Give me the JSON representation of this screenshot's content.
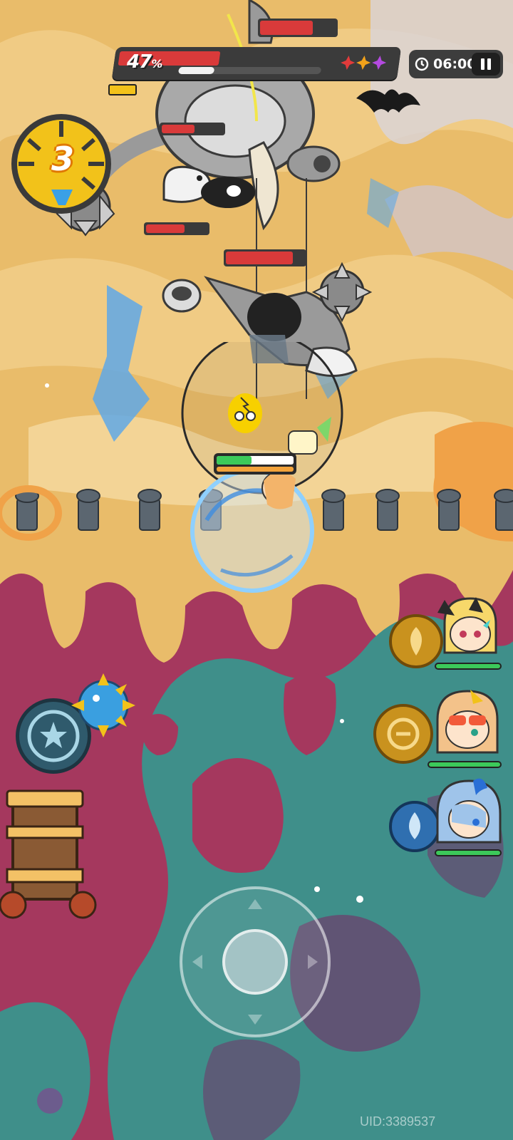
{
  "boss": {
    "hp_percent_value": "47",
    "hp_percent_symbol": "%",
    "hp_fraction": 0.47,
    "shield_fraction": 0.25
  },
  "timer": {
    "value": "06:00"
  },
  "combo": {
    "count": "3"
  },
  "player": {
    "hp_fraction": 0.45
  },
  "party": [
    {
      "name": "blonde-cat-ear-hero",
      "hp_fraction": 1.0
    },
    {
      "name": "orange-sunglasses-hero",
      "hp_fraction": 1.0
    },
    {
      "name": "blue-hair-hero",
      "hp_fraction": 1.0
    }
  ],
  "footer": {
    "uid": "UID:3389537"
  },
  "colors": {
    "sand": "#e9bc6a",
    "magenta": "#a5385e",
    "teal": "#3f8f8a",
    "hp_red": "#d93a3a",
    "hp_green": "#3cc95a"
  }
}
